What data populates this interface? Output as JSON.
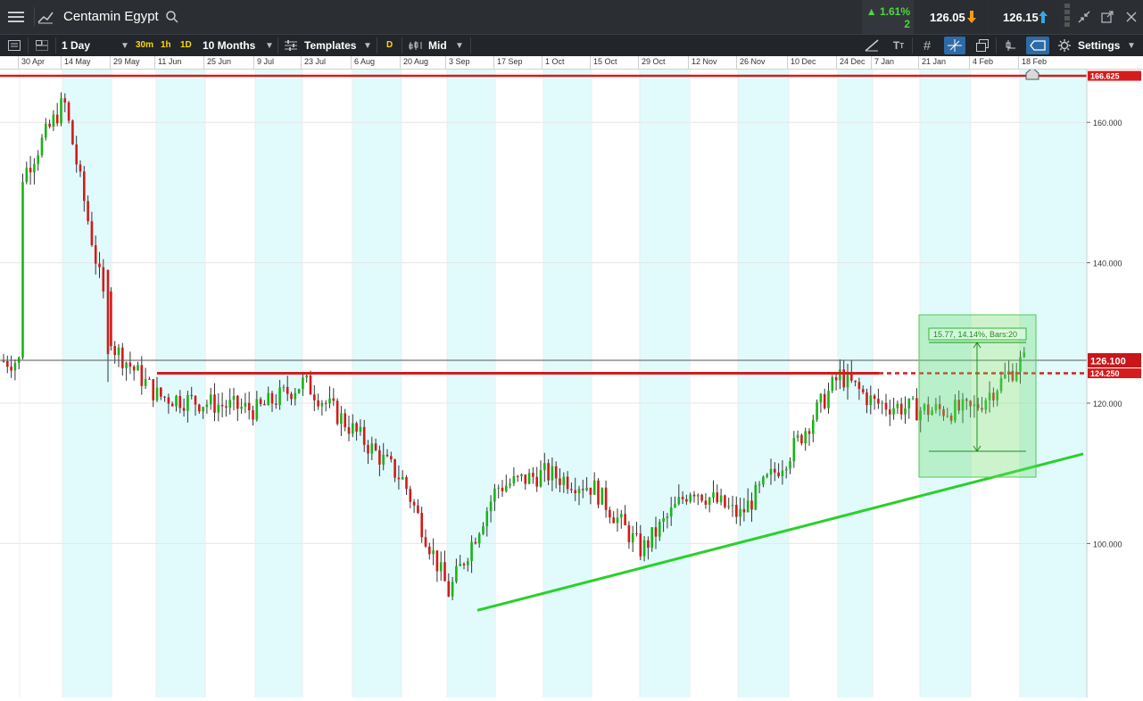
{
  "header": {
    "instrument_name": "Centamin Egypt",
    "change_pct": "▲ 1.61%",
    "change_value": "2",
    "sell_price": "126.05",
    "buy_price": "126.15"
  },
  "toolbar": {
    "interval": "1 Day",
    "quick_intervals": [
      "30m",
      "1h",
      "1D"
    ],
    "range": "10 Months",
    "templates_label": "Templates",
    "d_badge": "D",
    "price_type": "Mid",
    "settings_label": "Settings"
  },
  "chart_data": {
    "type": "candlestick",
    "x_ticks": [
      "30 Apr",
      "14 May",
      "29 May",
      "11 Jun",
      "25 Jun",
      "9 Jul",
      "23 Jul",
      "6 Aug",
      "20 Aug",
      "3 Sep",
      "17 Sep",
      "1 Oct",
      "15 Oct",
      "29 Oct",
      "12 Nov",
      "26 Nov",
      "10 Dec",
      "24 Dec",
      "7 Jan",
      "21 Jan",
      "4 Feb",
      "18 Feb"
    ],
    "y_ticks": [
      "160.000",
      "140.000",
      "120.000",
      "100.000"
    ],
    "price_labels": {
      "resistance_top": "166.625",
      "current": "126.100",
      "resistance_mid": "124.250"
    },
    "measure_label": "15.77, 14.14%, Bars:20",
    "levels": {
      "resistance_top": 166.625,
      "current": 126.1,
      "resistance_mid": 124.25
    },
    "trendline": {
      "from": {
        "date": "3 Sep",
        "price": 92.0
      },
      "to": {
        "date": "18 Feb",
        "price": 112.0
      }
    },
    "approx_closes": [
      {
        "date": "30 Apr",
        "price": 152
      },
      {
        "date": "14 May",
        "price": 163
      },
      {
        "date": "29 May",
        "price": 128
      },
      {
        "date": "11 Jun",
        "price": 121
      },
      {
        "date": "25 Jun",
        "price": 120
      },
      {
        "date": "9 Jul",
        "price": 119
      },
      {
        "date": "23 Jul",
        "price": 123
      },
      {
        "date": "6 Aug",
        "price": 116
      },
      {
        "date": "20 Aug",
        "price": 109
      },
      {
        "date": "3 Sep",
        "price": 93
      },
      {
        "date": "17 Sep",
        "price": 108
      },
      {
        "date": "1 Oct",
        "price": 110
      },
      {
        "date": "15 Oct",
        "price": 108
      },
      {
        "date": "29 Oct",
        "price": 99
      },
      {
        "date": "12 Nov",
        "price": 108
      },
      {
        "date": "26 Nov",
        "price": 104
      },
      {
        "date": "10 Dec",
        "price": 113
      },
      {
        "date": "24 Dec",
        "price": 124
      },
      {
        "date": "7 Jan",
        "price": 120
      },
      {
        "date": "21 Jan",
        "price": 119
      },
      {
        "date": "4 Feb",
        "price": 119
      },
      {
        "date": "18 Feb",
        "price": 126
      }
    ]
  }
}
